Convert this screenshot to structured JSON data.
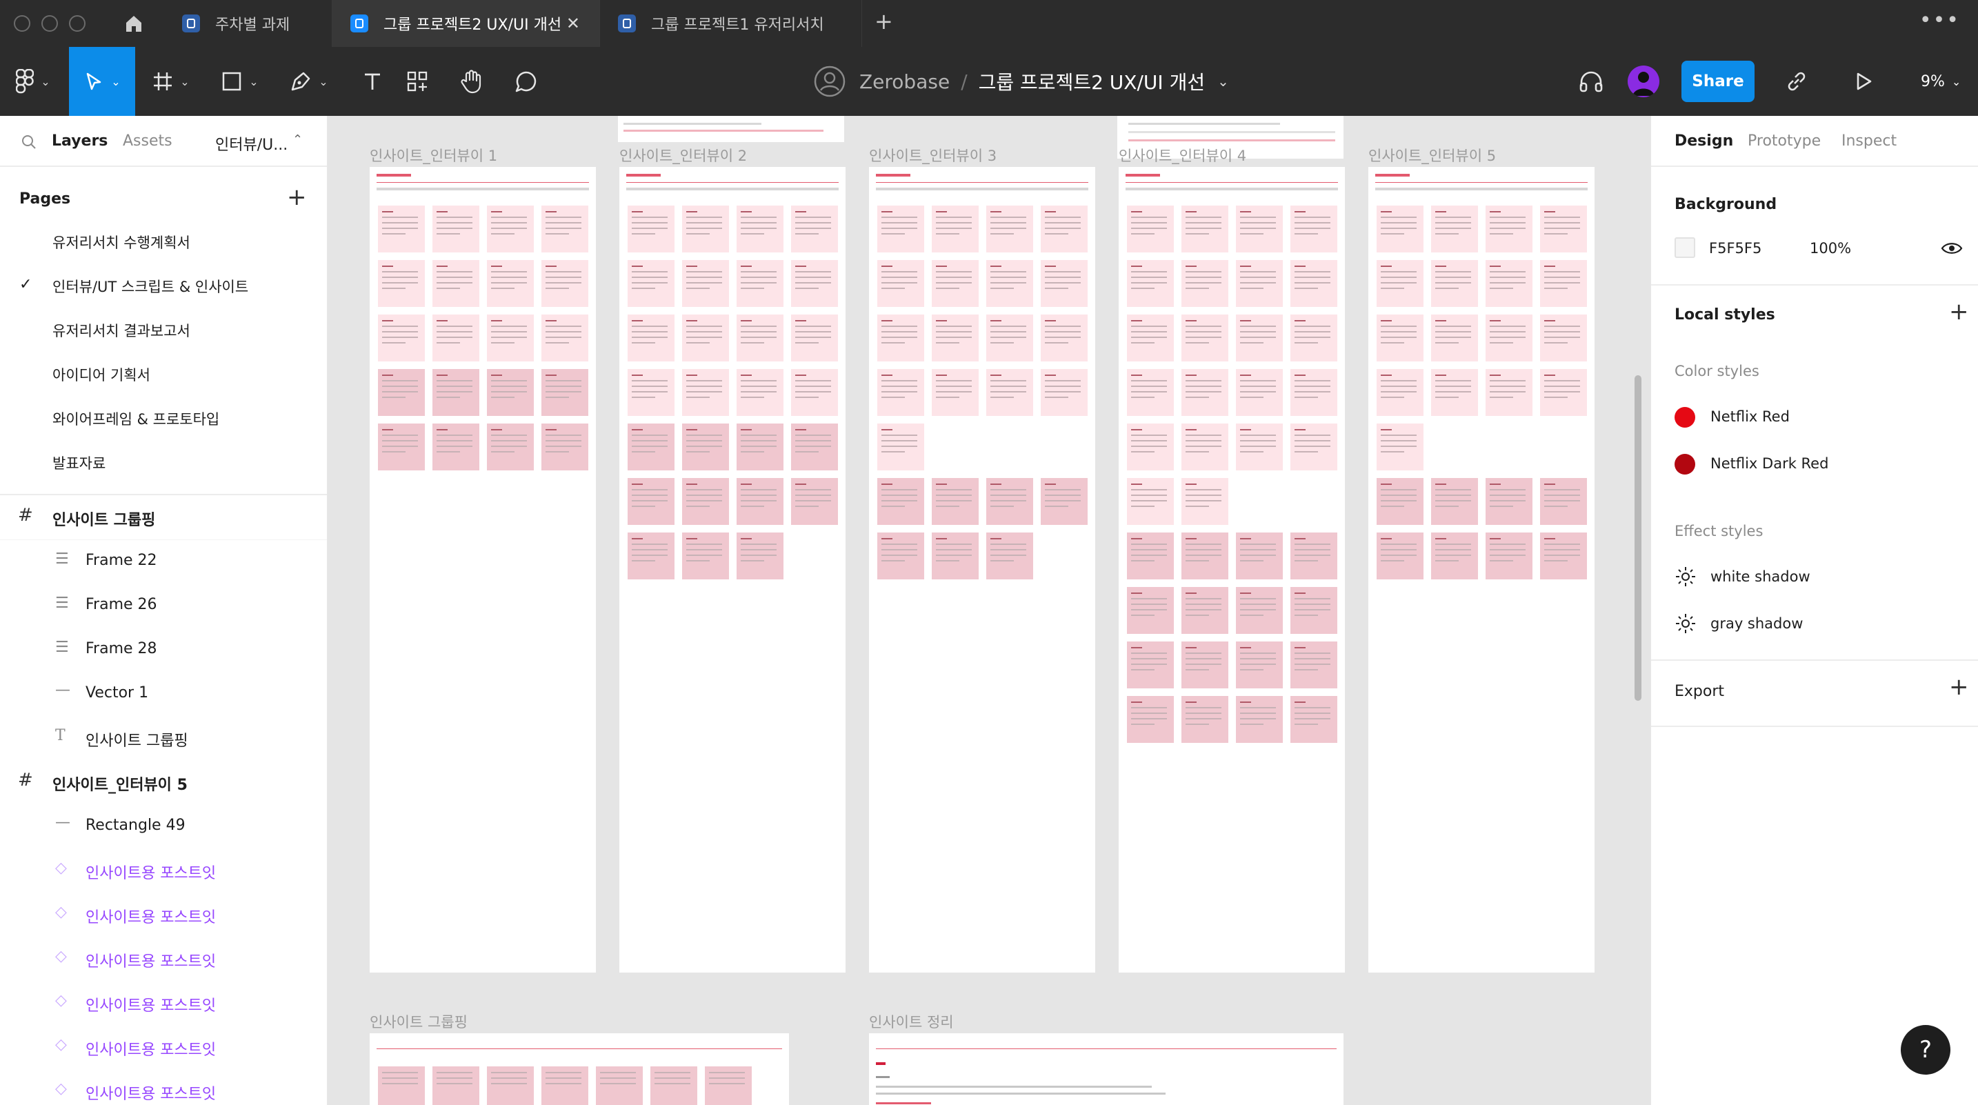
{
  "tabs": [
    {
      "label": "주차별 과제",
      "active": false
    },
    {
      "label": "그룹 프로젝트2 UX/UI 개선",
      "active": true
    },
    {
      "label": "그룹 프로젝트1 유저리서치",
      "active": false
    }
  ],
  "toolbar": {
    "workspace": "Zerobase",
    "separator": "/",
    "document": "그룹 프로젝트2 UX/UI 개선",
    "share_label": "Share",
    "zoom": "9%"
  },
  "left_panel": {
    "tabs": [
      "Layers",
      "Assets"
    ],
    "page_dropdown": "인터뷰/U...",
    "pages_heading": "Pages",
    "pages": [
      {
        "label": "유저리서치 수행계획서",
        "selected": false
      },
      {
        "label": "인터뷰/UT 스크립트 & 인사이트",
        "selected": true
      },
      {
        "label": "유저리서치 결과보고서",
        "selected": false
      },
      {
        "label": "아이디어 기획서",
        "selected": false
      },
      {
        "label": "와이어프레임 & 프로토타입",
        "selected": false
      },
      {
        "label": "발표자료",
        "selected": false
      }
    ],
    "layers": [
      {
        "label": "인사이트 그룹핑",
        "type": "frame",
        "icon": "frame-icon"
      },
      {
        "label": "Frame 22",
        "type": "child",
        "icon": "text-lines-icon"
      },
      {
        "label": "Frame 26",
        "type": "child",
        "icon": "text-lines-icon"
      },
      {
        "label": "Frame 28",
        "type": "child",
        "icon": "text-lines-icon"
      },
      {
        "label": "Vector 1",
        "type": "child",
        "icon": "line-icon"
      },
      {
        "label": "인사이트 그룹핑",
        "type": "child",
        "icon": "text-icon"
      },
      {
        "label": "인사이트_인터뷰이 5",
        "type": "frame",
        "icon": "frame-icon"
      },
      {
        "label": "Rectangle 49",
        "type": "child",
        "icon": "rectangle-icon"
      },
      {
        "label": "인사이트용 포스트잇",
        "type": "component",
        "icon": "component-instance-icon"
      },
      {
        "label": "인사이트용 포스트잇",
        "type": "component",
        "icon": "component-instance-icon"
      },
      {
        "label": "인사이트용 포스트잇",
        "type": "component",
        "icon": "component-instance-icon"
      },
      {
        "label": "인사이트용 포스트잇",
        "type": "component",
        "icon": "component-instance-icon"
      },
      {
        "label": "인사이트용 포스트잇",
        "type": "component",
        "icon": "component-instance-icon"
      },
      {
        "label": "인사이트용 포스트잇",
        "type": "component",
        "icon": "component-instance-icon"
      }
    ]
  },
  "right_panel": {
    "tabs": [
      "Design",
      "Prototype",
      "Inspect"
    ],
    "background_heading": "Background",
    "background_hex": "F5F5F5",
    "background_opacity": "100%",
    "local_styles_heading": "Local styles",
    "color_styles_heading": "Color styles",
    "color_styles": [
      {
        "name": "Netflix Red",
        "color": "#e50914"
      },
      {
        "name": "Netflix Dark Red",
        "color": "#b20710"
      }
    ],
    "effect_styles_heading": "Effect styles",
    "effect_styles": [
      "white shadow",
      "gray shadow"
    ],
    "export_heading": "Export"
  },
  "canvas": {
    "frames": [
      {
        "label": "인사이트_인터뷰이 1",
        "grid": [
          [
            1,
            1,
            1,
            1
          ],
          [
            1,
            1,
            1,
            1
          ],
          [
            1,
            1,
            1,
            1
          ],
          [
            2,
            2,
            2,
            2
          ],
          [
            2,
            2,
            2,
            2
          ]
        ]
      },
      {
        "label": "인사이트_인터뷰이 2",
        "grid": [
          [
            1,
            1,
            1,
            1
          ],
          [
            1,
            1,
            1,
            1
          ],
          [
            1,
            1,
            1,
            1
          ],
          [
            1,
            1,
            1,
            1
          ],
          [
            2,
            2,
            2,
            2
          ],
          [
            2,
            2,
            2,
            2
          ],
          [
            2,
            2,
            2,
            0
          ]
        ]
      },
      {
        "label": "인사이트_인터뷰이 3",
        "grid": [
          [
            1,
            1,
            1,
            1
          ],
          [
            1,
            1,
            1,
            1
          ],
          [
            1,
            1,
            1,
            1
          ],
          [
            1,
            1,
            1,
            1
          ],
          [
            1,
            0,
            0,
            0
          ],
          [
            2,
            2,
            2,
            2
          ],
          [
            2,
            2,
            2,
            0
          ]
        ]
      },
      {
        "label": "인사이트_인터뷰이 4",
        "grid": [
          [
            1,
            1,
            1,
            1
          ],
          [
            1,
            1,
            1,
            1
          ],
          [
            1,
            1,
            1,
            1
          ],
          [
            1,
            1,
            1,
            1
          ],
          [
            1,
            1,
            1,
            1
          ],
          [
            1,
            1,
            0,
            0
          ],
          [
            2,
            2,
            2,
            2
          ],
          [
            2,
            2,
            2,
            2
          ],
          [
            2,
            2,
            2,
            2
          ],
          [
            2,
            2,
            2,
            2
          ]
        ]
      },
      {
        "label": "인사이트_인터뷰이 5",
        "grid": [
          [
            1,
            1,
            1,
            1
          ],
          [
            1,
            1,
            1,
            1
          ],
          [
            1,
            1,
            1,
            1
          ],
          [
            1,
            1,
            1,
            1
          ],
          [
            1,
            0,
            0,
            0
          ],
          [
            2,
            2,
            2,
            2
          ],
          [
            2,
            2,
            2,
            2
          ]
        ]
      }
    ],
    "bottom_frames": [
      {
        "label": "인사이트 그룹핑"
      },
      {
        "label": "인사이트 정리"
      }
    ],
    "note_colors": {
      "light": "#fde4e8",
      "dark": "#f0c7cf"
    },
    "component_markers": [
      "❖ ...",
      "❖ ..."
    ]
  },
  "help_label": "?"
}
